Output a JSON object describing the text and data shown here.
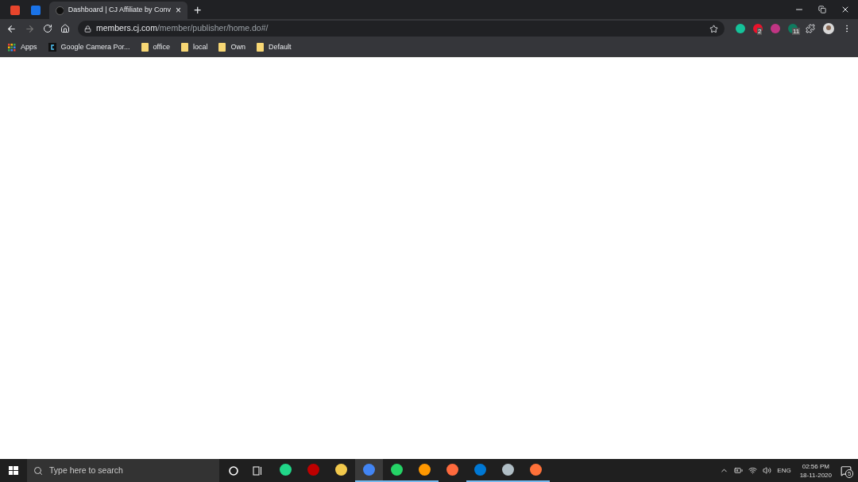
{
  "tabs": [
    {
      "kind": "pinned",
      "selected": false,
      "color": "#e8452c"
    },
    {
      "kind": "pinned",
      "selected": false,
      "color": "#1a73e8"
    },
    {
      "kind": "page",
      "selected": true,
      "title": "Dashboard | CJ Affiliate by Conv",
      "close": "×"
    }
  ],
  "new_tab": "+",
  "address": {
    "host": "members.cj.com",
    "path": "/member/publisher/home.do#/"
  },
  "extensions": [
    {
      "color": "#15c39a"
    },
    {
      "color": "#e8132b",
      "badge": "2"
    },
    {
      "color": "#c13584"
    },
    {
      "color": "#0f7b5f",
      "badge": "11"
    }
  ],
  "bookmarks": [
    {
      "kind": "apps",
      "label": "Apps"
    },
    {
      "kind": "site",
      "label": "Google Camera Por..."
    },
    {
      "kind": "folder",
      "label": "office"
    },
    {
      "kind": "folder",
      "label": "local"
    },
    {
      "kind": "folder",
      "label": "Own"
    },
    {
      "kind": "folder",
      "label": "Default"
    }
  ],
  "taskbar": {
    "search_placeholder": "Type here to search",
    "apps": [
      {
        "color": "#21d789",
        "running": false,
        "selected": false
      },
      {
        "color": "#bf0000",
        "running": false,
        "selected": false
      },
      {
        "color": "#f2c94c",
        "running": false,
        "selected": false
      },
      {
        "color": "#4285f4",
        "running": true,
        "selected": true
      },
      {
        "color": "#25d366",
        "running": true,
        "selected": false
      },
      {
        "color": "#ff9800",
        "running": true,
        "selected": false
      },
      {
        "color": "#ff6a3d",
        "running": false,
        "selected": false
      },
      {
        "color": "#0078d4",
        "running": true,
        "selected": false
      },
      {
        "color": "#b0bec5",
        "running": true,
        "selected": false
      },
      {
        "color": "#ff7139",
        "running": true,
        "selected": false
      }
    ],
    "language": "ENG",
    "time": "02:56 PM",
    "date": "18-11-2020",
    "notifications": "5"
  }
}
